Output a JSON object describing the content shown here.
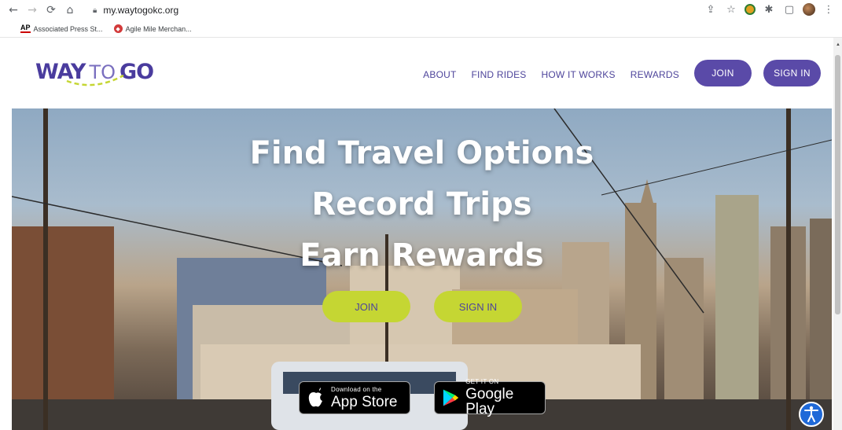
{
  "browser": {
    "url": "my.waytogokc.org",
    "bookmarks": [
      {
        "label": "Associated Press St..."
      },
      {
        "label": "Agile Mile Merchan..."
      }
    ],
    "ap_logo_text": "AP"
  },
  "site": {
    "logo": {
      "way": "WAY",
      "to": "TO",
      "go": "GO"
    },
    "nav": {
      "about": "ABOUT",
      "find_rides": "FIND RIDES",
      "how_it_works": "HOW IT WORKS",
      "rewards": "REWARDS"
    },
    "join_label": "JOIN",
    "signin_label": "SIGN IN",
    "colors": {
      "primary": "#5a4aa8",
      "accent": "#c5d633"
    }
  },
  "hero": {
    "line1": "Find Travel Options",
    "line2": "Record Trips",
    "line3": "Earn Rewards",
    "join_label": "JOIN",
    "signin_label": "SIGN IN",
    "appstore_small": "Download on the",
    "appstore_big": "App Store",
    "play_small": "GET IT ON",
    "play_big": "Google Play"
  }
}
